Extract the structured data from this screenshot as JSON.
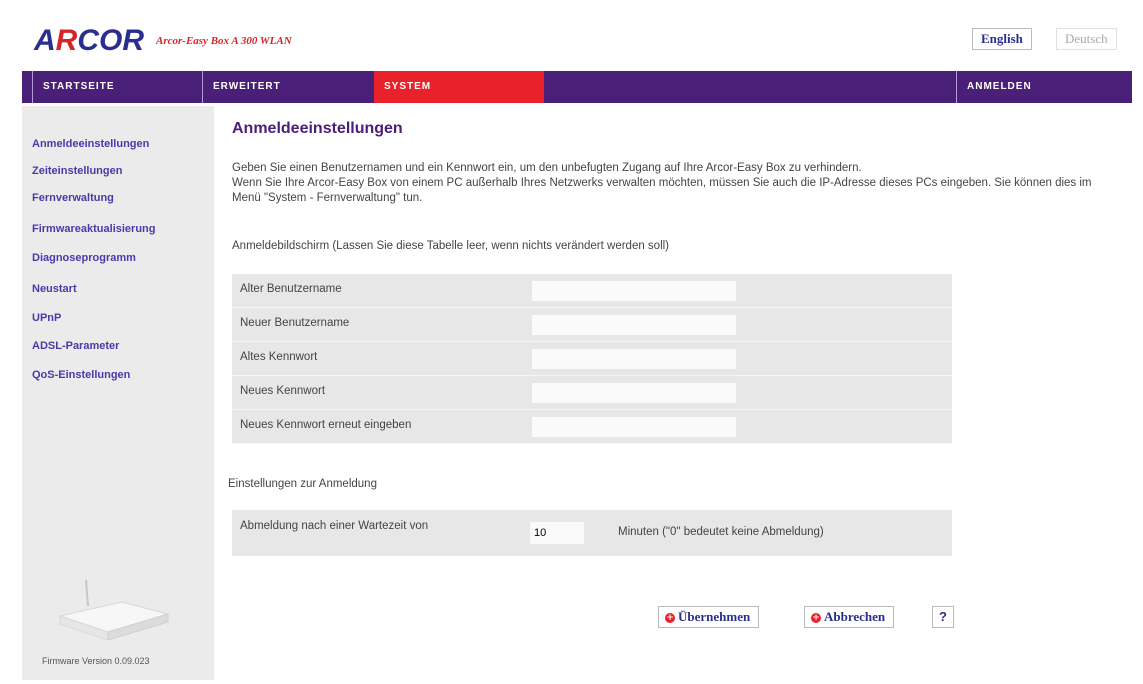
{
  "header": {
    "logo_a": "A",
    "logo_r": "R",
    "logo_rest": "COR",
    "tagline": "Arcor-Easy Box A 300 WLAN",
    "lang_english": "English",
    "lang_deutsch": "Deutsch"
  },
  "nav": {
    "startseite": "STARTSEITE",
    "erweitert": "ERWEITERT",
    "system": "SYSTEM",
    "anmelden": "ANMELDEN"
  },
  "sidebar": {
    "items": [
      {
        "label": "Anmeldeeinstellungen"
      },
      {
        "label": "Zeiteinstellungen"
      },
      {
        "label": "Fernverwaltung"
      },
      {
        "label": "Firmwareaktualisierung"
      },
      {
        "label": "Diagnoseprogramm"
      },
      {
        "label": "Neustart"
      },
      {
        "label": "UPnP"
      },
      {
        "label": "ADSL-Parameter"
      },
      {
        "label": "QoS-Einstellungen"
      }
    ],
    "firmware": "Firmware Version 0.09.023"
  },
  "main": {
    "title": "Anmeldeeinstellungen",
    "intro_line1": "Geben Sie einen Benutzernamen und ein Kennwort ein, um den unbefugten Zugang auf Ihre Arcor-Easy Box zu verhindern.",
    "intro_line2": "Wenn Sie Ihre Arcor-Easy Box von einem PC außerhalb Ihres Netzwerks verwalten möchten, müssen Sie auch die IP-Adresse dieses PCs eingeben. Sie können dies im Menü \"System - Fernverwaltung\" tun.",
    "login_screen_heading": "Anmeldebildschirm (Lassen Sie diese Tabelle leer, wenn nichts verändert werden soll)",
    "fields": [
      {
        "label": "Alter Benutzername",
        "value": ""
      },
      {
        "label": "Neuer Benutzername",
        "value": ""
      },
      {
        "label": "Altes Kennwort",
        "value": ""
      },
      {
        "label": "Neues Kennwort",
        "value": ""
      },
      {
        "label": "Neues Kennwort erneut eingeben",
        "value": ""
      }
    ],
    "login_settings_heading": "Einstellungen zur Anmeldung",
    "logout_label": "Abmeldung nach einer Wartezeit von",
    "logout_value": "10",
    "logout_unit": "Minuten (\"0\" bedeutet keine Abmeldung)",
    "apply_label": "Übernehmen",
    "cancel_label": "Abbrechen",
    "help_label": "?"
  }
}
